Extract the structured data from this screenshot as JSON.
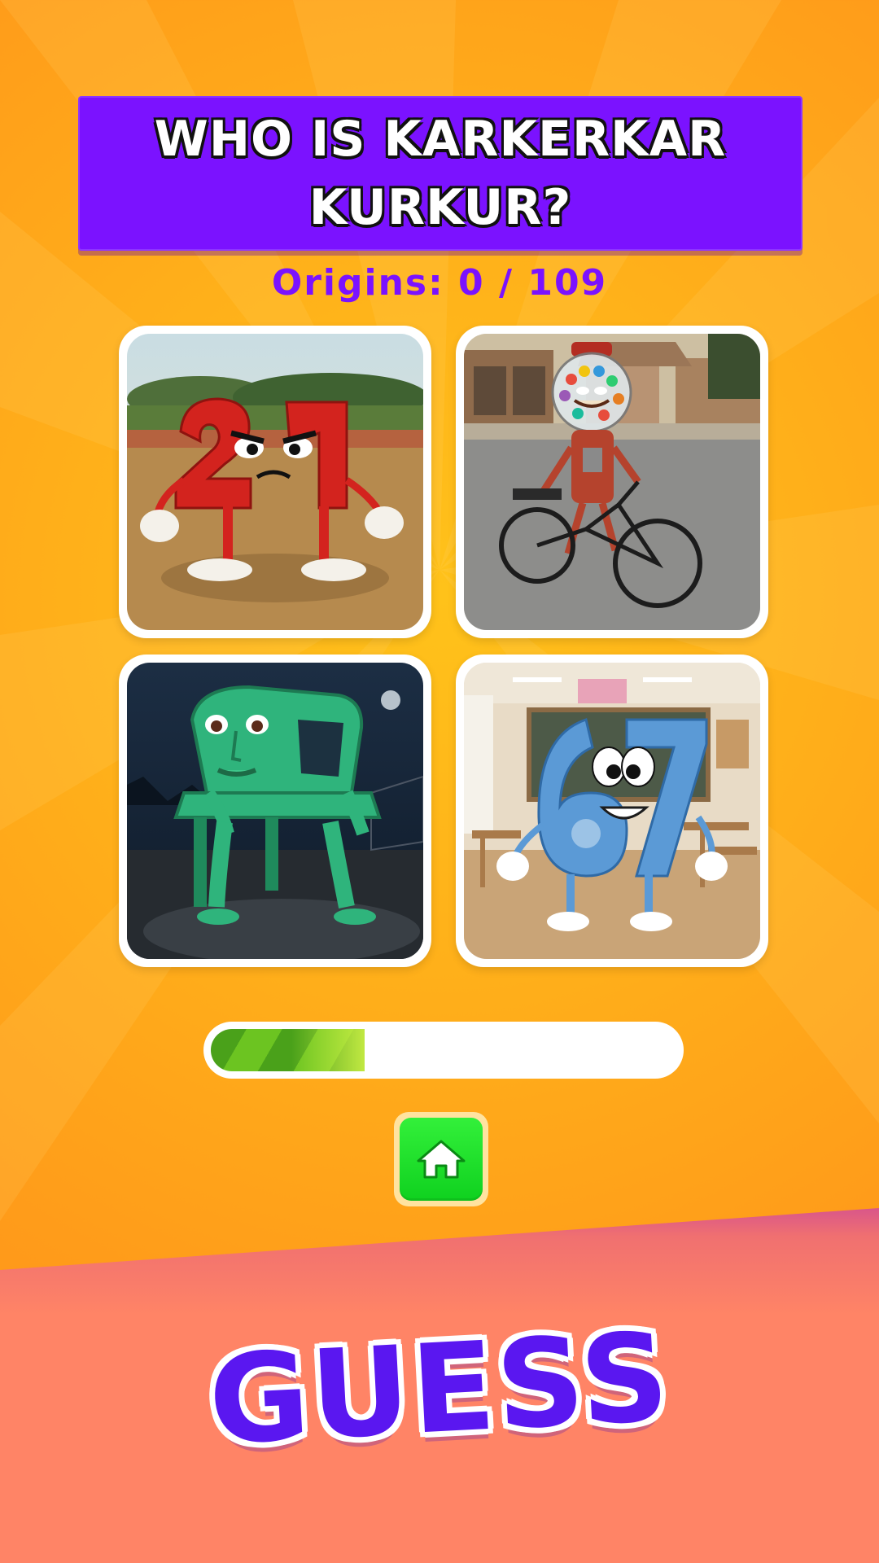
{
  "question": {
    "title": "WHO IS KARKERKAR KURKUR?"
  },
  "progress": {
    "label": "Origins: 0 / 109",
    "fill_fraction": 0.33
  },
  "options": [
    {
      "id": 1,
      "icon": "number-21-character-image"
    },
    {
      "id": 2,
      "icon": "gumball-machine-cyclist-image"
    },
    {
      "id": 3,
      "icon": "green-chair-character-image"
    },
    {
      "id": 4,
      "icon": "number-67-character-image"
    }
  ],
  "controls": {
    "home_icon": "home-icon"
  },
  "footer": {
    "banner_text": "GUESS"
  },
  "colors": {
    "background": "#ffb01a",
    "banner": "#7b12ff",
    "accent_text": "#7b12ff",
    "progress_fill": "#4aa11a",
    "home_button": "#1fe02a",
    "footer_band": "#ff8466",
    "guess_text": "#5a17f0"
  }
}
